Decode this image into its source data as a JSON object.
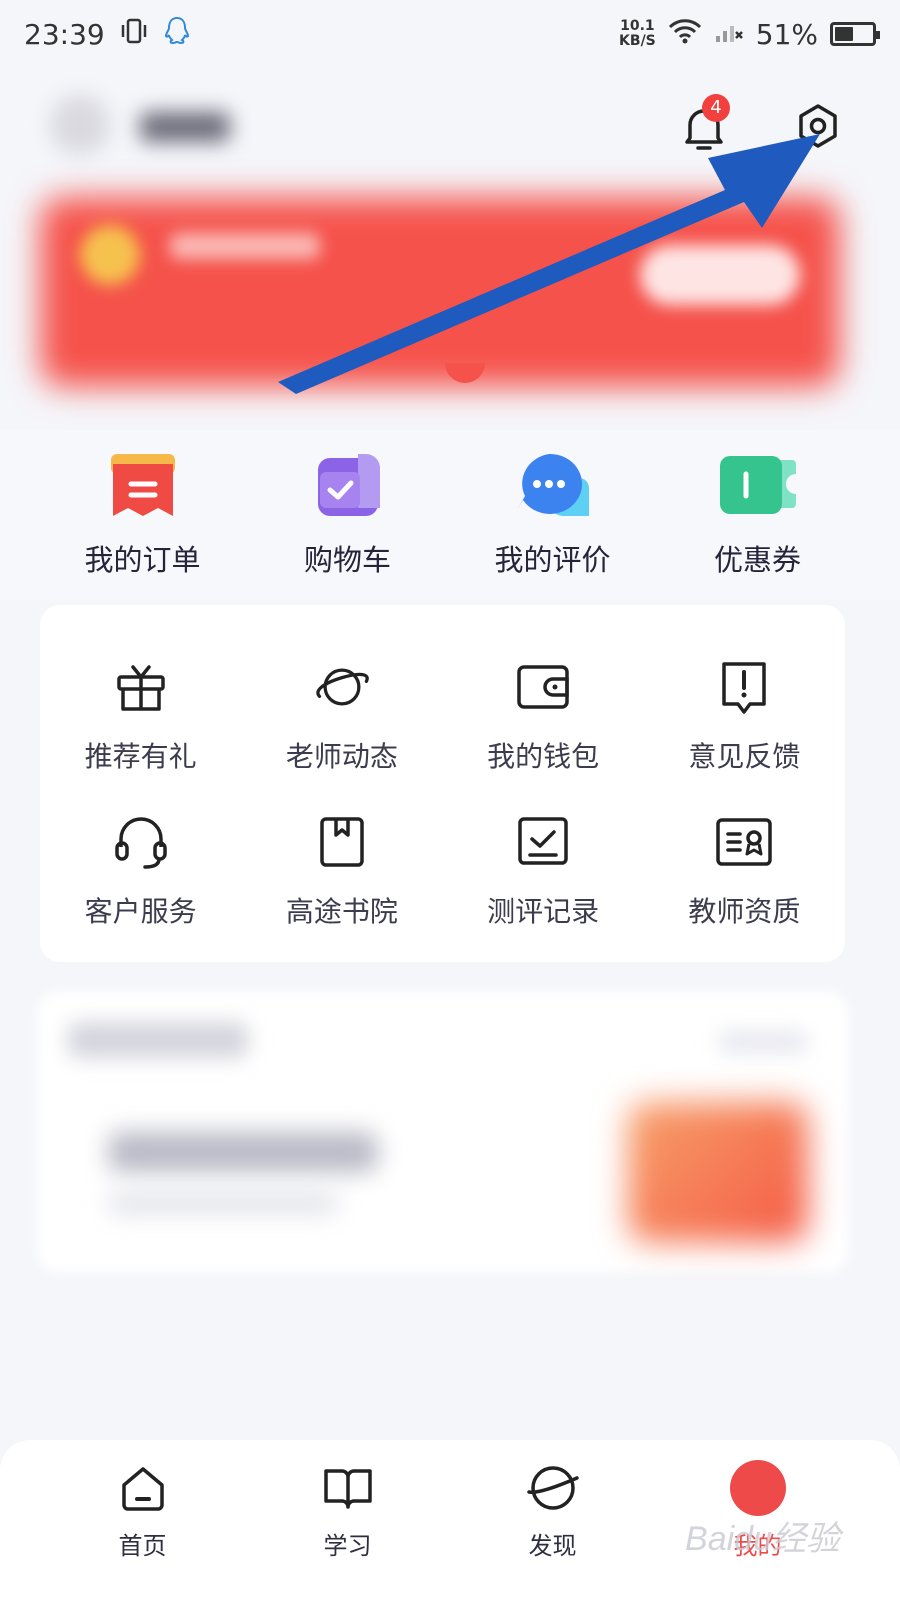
{
  "status_bar": {
    "time": "23:39",
    "net_speed_value": "10.1",
    "net_speed_unit": "KB/S",
    "battery": "51%"
  },
  "header": {
    "notification_badge": "4"
  },
  "quick_actions": [
    {
      "label": "我的订单",
      "icon": "order-icon"
    },
    {
      "label": "购物车",
      "icon": "cart-icon"
    },
    {
      "label": "我的评价",
      "icon": "review-icon"
    },
    {
      "label": "优惠券",
      "icon": "coupon-icon"
    }
  ],
  "services": [
    {
      "label": "推荐有礼",
      "icon": "gift-icon"
    },
    {
      "label": "老师动态",
      "icon": "planet-icon"
    },
    {
      "label": "我的钱包",
      "icon": "wallet-icon"
    },
    {
      "label": "意见反馈",
      "icon": "feedback-icon"
    },
    {
      "label": "客户服务",
      "icon": "headset-icon"
    },
    {
      "label": "高途书院",
      "icon": "book-icon"
    },
    {
      "label": "测评记录",
      "icon": "assessment-icon"
    },
    {
      "label": "教师资质",
      "icon": "certificate-icon"
    }
  ],
  "bottom_nav": [
    {
      "label": "首页",
      "icon": "home-icon"
    },
    {
      "label": "学习",
      "icon": "study-book-icon"
    },
    {
      "label": "发现",
      "icon": "discover-icon"
    },
    {
      "label": "我的",
      "icon": "profile-icon",
      "active": true
    }
  ],
  "colors": {
    "accent": "#ef4a4a",
    "arrow": "#1f5bbf",
    "banner": "#f5524b"
  },
  "watermark": "Baidu经验"
}
